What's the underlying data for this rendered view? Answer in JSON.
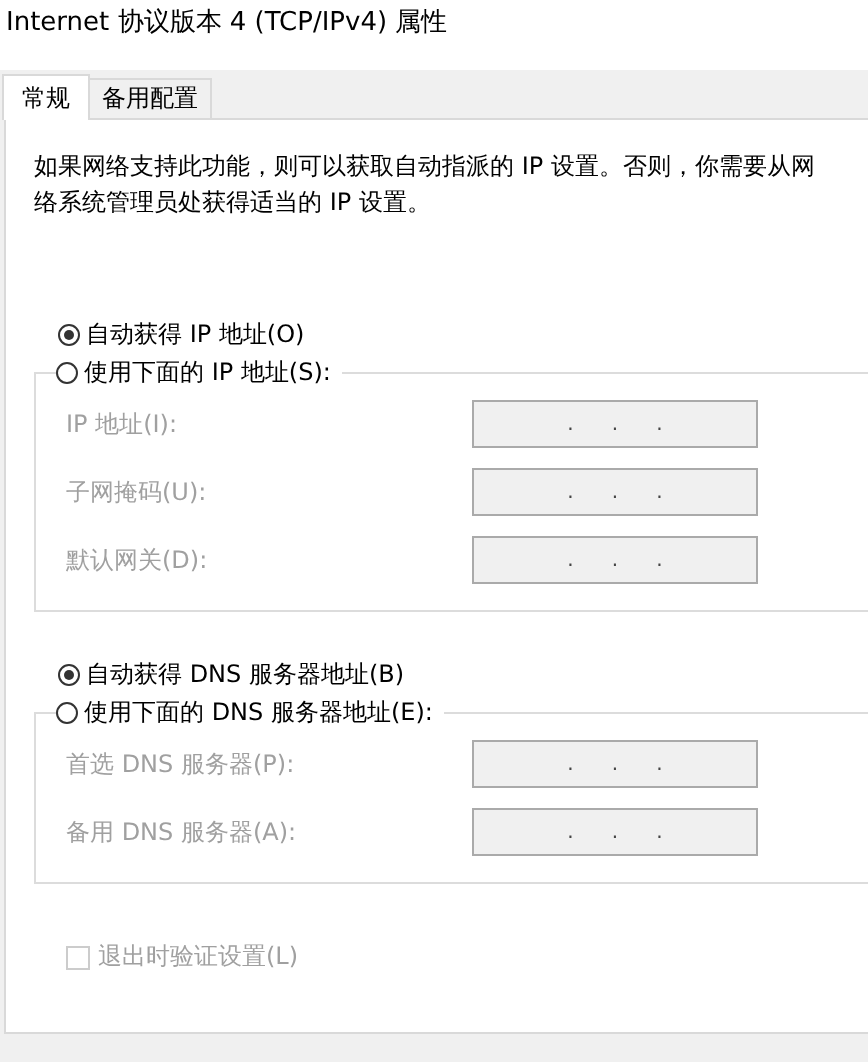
{
  "window": {
    "title": "Internet 协议版本 4 (TCP/IPv4) 属性"
  },
  "tabs": [
    {
      "label": "常规",
      "selected": true
    },
    {
      "label": "备用配置",
      "selected": false
    }
  ],
  "description": "如果网络支持此功能，则可以获取自动指派的 IP 设置。否则，你需要从网络系统管理员处获得适当的 IP 设置。",
  "groups": [
    {
      "options": [
        {
          "label": "自动获得 IP 地址(O)",
          "selected": true
        },
        {
          "label": "使用下面的 IP 地址(S):",
          "selected": false
        }
      ],
      "fields": [
        {
          "label": "IP 地址(I):",
          "value": ".      .      .",
          "disabled": true
        },
        {
          "label": "子网掩码(U):",
          "value": ".      .      .",
          "disabled": true
        },
        {
          "label": "默认网关(D):",
          "value": ".      .      .",
          "disabled": true
        }
      ]
    },
    {
      "options": [
        {
          "label": "自动获得 DNS 服务器地址(B)",
          "selected": true
        },
        {
          "label": "使用下面的 DNS 服务器地址(E):",
          "selected": false
        }
      ],
      "fields": [
        {
          "label": "首选 DNS 服务器(P):",
          "value": ".      .      .",
          "disabled": true
        },
        {
          "label": "备用 DNS 服务器(A):",
          "value": ".      .      .",
          "disabled": true
        }
      ]
    }
  ],
  "validate_checkbox": {
    "label": "退出时验证设置(L)",
    "checked": false,
    "disabled": true
  }
}
